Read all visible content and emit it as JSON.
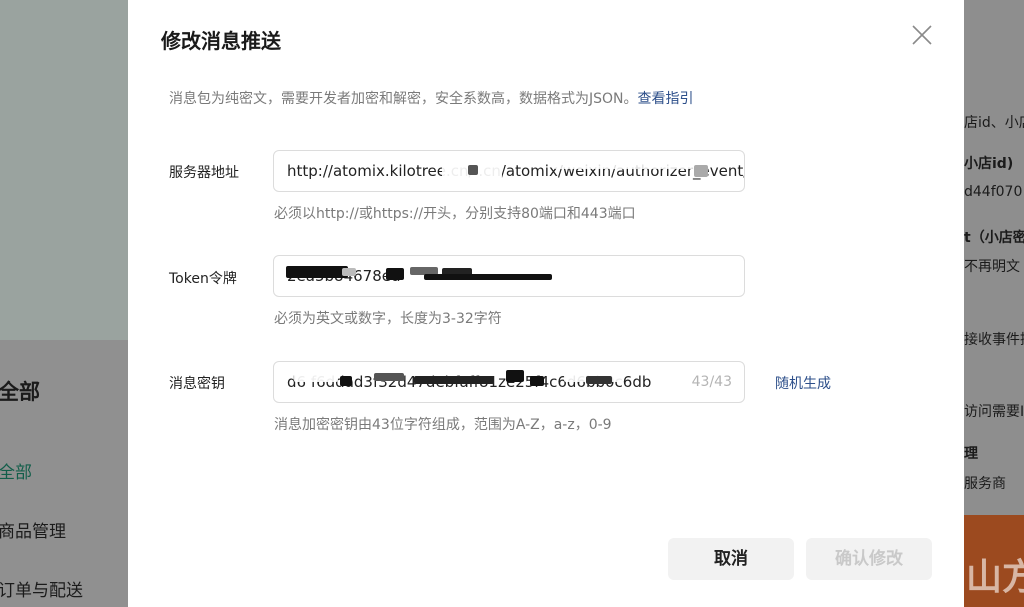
{
  "background": {
    "left_nav": {
      "title": "全部",
      "items": [
        {
          "label": "全部",
          "active": true
        },
        {
          "label": "商品管理",
          "active": false
        },
        {
          "label": "订单与配送",
          "active": false
        }
      ]
    },
    "right_panel": {
      "lines": [
        "店id、小店",
        "小店id)",
        "d44f070",
        "t（小店密",
        "不再明文",
        "接收事件推",
        "访问需要IP",
        "理",
        "服务商"
      ],
      "banner_text": "山方"
    }
  },
  "modal": {
    "title": "修改消息推送",
    "description": "消息包为纯密文，需要开发者加密和解密，安全系数高，数据格式为JSON。",
    "description_link": "查看指引",
    "fields": {
      "server_url": {
        "label": "服务器地址",
        "value": "http://atomix.kilotree.cn/       .cn/atomix/weixin/authorizer_event/",
        "hint": "必须以http://或https://开头，分别支持80端口和443端口"
      },
      "token": {
        "label": "Token令牌",
        "value": "2ea5b84678ed",
        "hint": "必须为英文或数字，长度为3-32字符"
      },
      "aes_key": {
        "label": "消息密钥",
        "value": "d6          f6ddad3f32d47debfaff81ze25f4c6d6bb0c6db",
        "counter": "43/43",
        "random_label": "随机生成",
        "hint": "消息加密密钥由43位字符组成，范围为A-Z，a-z，0-9"
      }
    },
    "buttons": {
      "cancel": "取消",
      "confirm": "确认修改"
    },
    "colors": {
      "link": "#2d4f8a",
      "disabled_text": "#c9c9c9",
      "hint": "#7a7a7a"
    }
  }
}
